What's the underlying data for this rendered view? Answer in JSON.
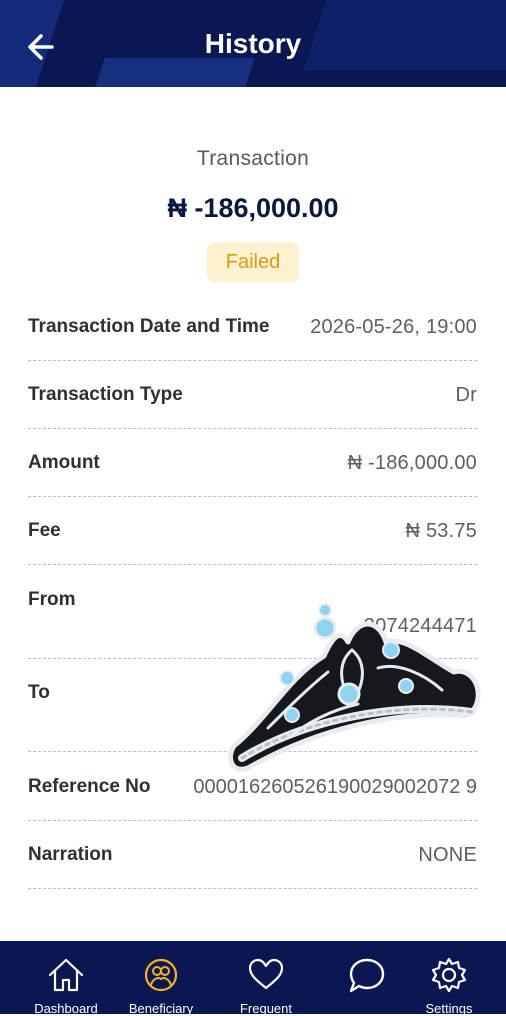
{
  "header": {
    "title": "History",
    "back_icon": "arrow-left-icon",
    "background": "#0a1752"
  },
  "summary": {
    "label": "Transaction",
    "amount": "₦ -186,000.00",
    "status": "Failed",
    "status_color": "#d39d16",
    "status_bg": "#fdf1cf"
  },
  "details": [
    {
      "label": "Transaction Date and Time",
      "value": "2026-05-26, 19:00"
    },
    {
      "label": "Transaction Type",
      "value": "Dr"
    },
    {
      "label": "Amount",
      "value": "₦ -186,000.00"
    },
    {
      "label": "Fee",
      "value": "₦ 53.75"
    },
    {
      "label": "From",
      "value": "3074244471"
    },
    {
      "label": "To",
      "value": ""
    },
    {
      "label": "Reference No",
      "value": "000016260526190029002072 9"
    },
    {
      "label": "Narration",
      "value": "NONE"
    }
  ],
  "overlay": {
    "icon": "crown-sticker-icon"
  },
  "nav": {
    "items": [
      {
        "label": "Dashboard",
        "icon": "home-icon",
        "active": false
      },
      {
        "label": "Beneficiary",
        "icon": "beneficiary-icon",
        "active": true
      },
      {
        "label": "Frequent",
        "icon": "heart-icon",
        "active": false
      },
      {
        "label": "",
        "icon": "chat-icon",
        "active": false
      },
      {
        "label": "Settings",
        "icon": "gear-icon",
        "active": false
      }
    ],
    "active_color": "#f2b51d"
  }
}
